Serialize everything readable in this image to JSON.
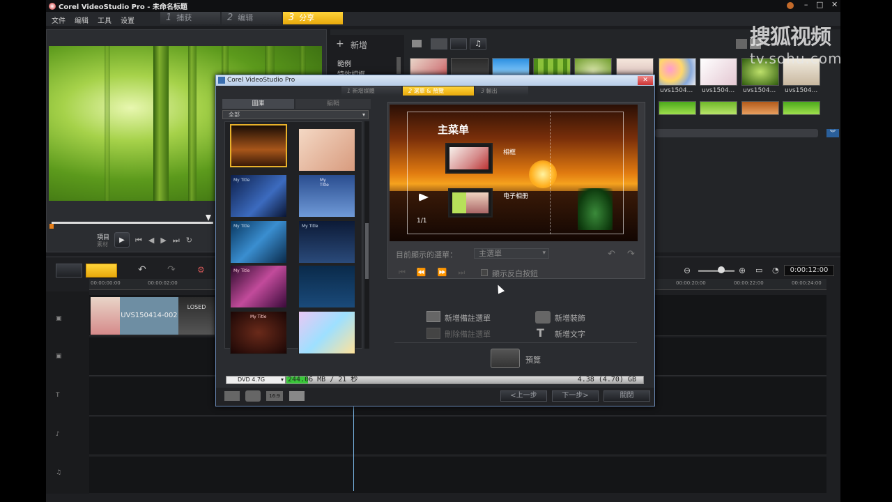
{
  "app": {
    "title": "Corel VideoStudio Pro - 未命名标题",
    "menu": [
      "文件",
      "编辑",
      "工具",
      "设置"
    ],
    "steps": [
      {
        "num": "1",
        "label": "捕获"
      },
      {
        "num": "2",
        "label": "编辑"
      },
      {
        "num": "3",
        "label": "分享"
      }
    ]
  },
  "watermark": {
    "logo": "搜狐视频",
    "url": "tv.sohu.com"
  },
  "library": {
    "add_label": "新增",
    "categories": [
      "範例",
      "特效相框"
    ],
    "thumb_captions": [
      "uvs1504...",
      "uvs1504...",
      "uvs1504...",
      "uvs1504..."
    ]
  },
  "preview": {
    "mode_project": "項目",
    "mode_clip": "素材"
  },
  "timeline": {
    "ruler": [
      "00:00:00:00",
      "00:00:02:00",
      "00:00:20:00",
      "00:00:22:00",
      "00:00:24:00"
    ],
    "clip_label": "UVS150414-002",
    "clip_thumb_text": "LOSED",
    "timecode": "0:00:12:00"
  },
  "dialog": {
    "title": "Corel VideoStudio Pro",
    "steps": [
      {
        "num": "1",
        "label": "新增媒體"
      },
      {
        "num": "2",
        "label": "選單 & 預覽"
      },
      {
        "num": "3",
        "label": "輸出"
      }
    ],
    "tabs": [
      "圖庫",
      "編輯"
    ],
    "filter": "全部",
    "template_titles": [
      "My Title",
      "My Title",
      "My Title",
      "My Title",
      "My Title",
      "My Title"
    ],
    "menu_preview": {
      "main_title": "主菜单",
      "item1": "相框",
      "item2": "电子相册",
      "page": "1/1"
    },
    "current_menu_label": "目前顯示的選單：",
    "current_menu_value": "主選單",
    "show_inverse": "顯示反白按鈕",
    "actions": {
      "add_note_menu": "新增備註選單",
      "delete_note_menu": "刪除備註選單",
      "add_decoration": "新增裝飾",
      "add_text": "新增文字",
      "preview": "預覽"
    },
    "disc": {
      "type": "DVD 4.7G",
      "used": "244.06 MB / 21 秒",
      "capacity": "4.38 (4.70) GB",
      "used_fraction": 0.06
    },
    "buttons": {
      "back": "<上一步",
      "next": "下一步>",
      "close": "關閉"
    }
  }
}
